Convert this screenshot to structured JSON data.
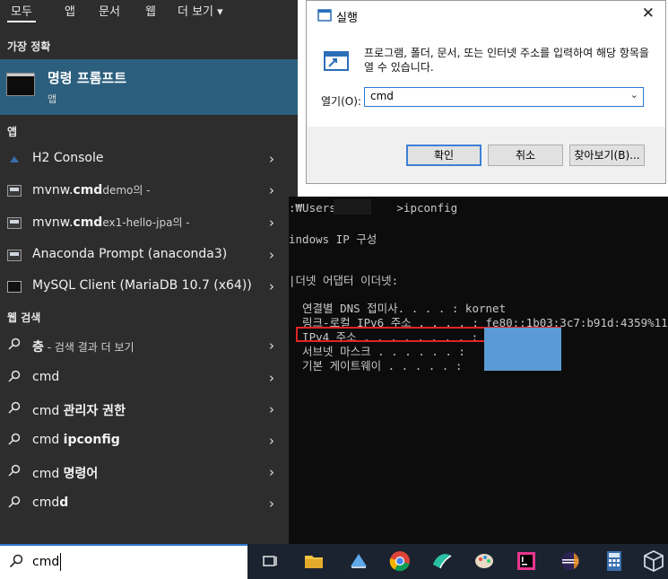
{
  "start": {
    "tabs": [
      "모두",
      "앱",
      "문서",
      "웹",
      "더 보기"
    ],
    "best_match_heading": "가장 정확",
    "best_match": {
      "title": "명령 프롬프트",
      "type": "앱"
    },
    "apps_heading": "앱",
    "apps": [
      {
        "icon": "h2-icon",
        "bold": "",
        "text": "H2 Console",
        "sub": ""
      },
      {
        "icon": "shell-window-icon",
        "pre": "mvnw.",
        "bold": "cmd",
        "sub": "demo의 -"
      },
      {
        "icon": "shell-window-icon",
        "pre": "mvnw.",
        "bold": "cmd",
        "sub": "ex1-hello-jpa의 -"
      },
      {
        "icon": "anaconda-prompt-icon",
        "pre": "Anaconda Prompt (anaconda3)",
        "bold": "",
        "sub": ""
      },
      {
        "icon": "mysql-client-icon",
        "pre": "MySQL Client (MariaDB 10.7 (x64))",
        "bold": "",
        "sub": ""
      }
    ],
    "web_heading": "웹 검색",
    "web": [
      {
        "pre": "",
        "bold": "층",
        "post": "",
        "sub": " - 검색 결과 더 보기"
      },
      {
        "pre": "cmd",
        "bold": "",
        "post": ""
      },
      {
        "pre": "cmd ",
        "bold": "관리자 권한",
        "post": ""
      },
      {
        "pre": "cmd ",
        "bold": "ipconfig",
        "post": ""
      },
      {
        "pre": "cmd ",
        "bold": "명령어",
        "post": ""
      },
      {
        "pre": "cmd",
        "bold": "d",
        "post": ""
      }
    ],
    "chevron": "›"
  },
  "run_dialog": {
    "title": "실행",
    "close": "✕",
    "description": "프로그램, 폴더, 문서, 또는 인터넷 주소를 입력하여 해당 항목을 열 수 있습니다.",
    "open_label": "열기(O):",
    "open_value": "cmd",
    "ok": "확인",
    "cancel": "취소",
    "browse": "찾아보기(B)..."
  },
  "console": {
    "lines": [
      ":₩Users₩        >ipconfig",
      "",
      "indows IP 구성",
      "",
      "",
      "|더넷 어댑터 이더넷:",
      "",
      "  연결별 DNS 접미사. . . . : kornet",
      "  링크-로컬 IPv6 주소 . . . . : fe80::1b03:3c7:b91d:4359%11",
      "  IPv4 주소 . . . . . . . . :",
      "  서브넷 마스크 . . . . . . :            0",
      "  기본 게이트웨이 . . . . . :            4"
    ]
  },
  "taskbar": {
    "search_value": "cmd",
    "icons": [
      "task-view-icon",
      "file-explorer-icon",
      "devices-icon",
      "chrome-icon",
      "app-icon",
      "paint-icon",
      "intellij-icon",
      "eclipse-icon",
      "calculator-icon",
      "virtualbox-icon"
    ],
    "colors": {
      "bg": "#1b2330",
      "accent": "#2f78d1",
      "highlight": "#2c5f7e"
    }
  }
}
